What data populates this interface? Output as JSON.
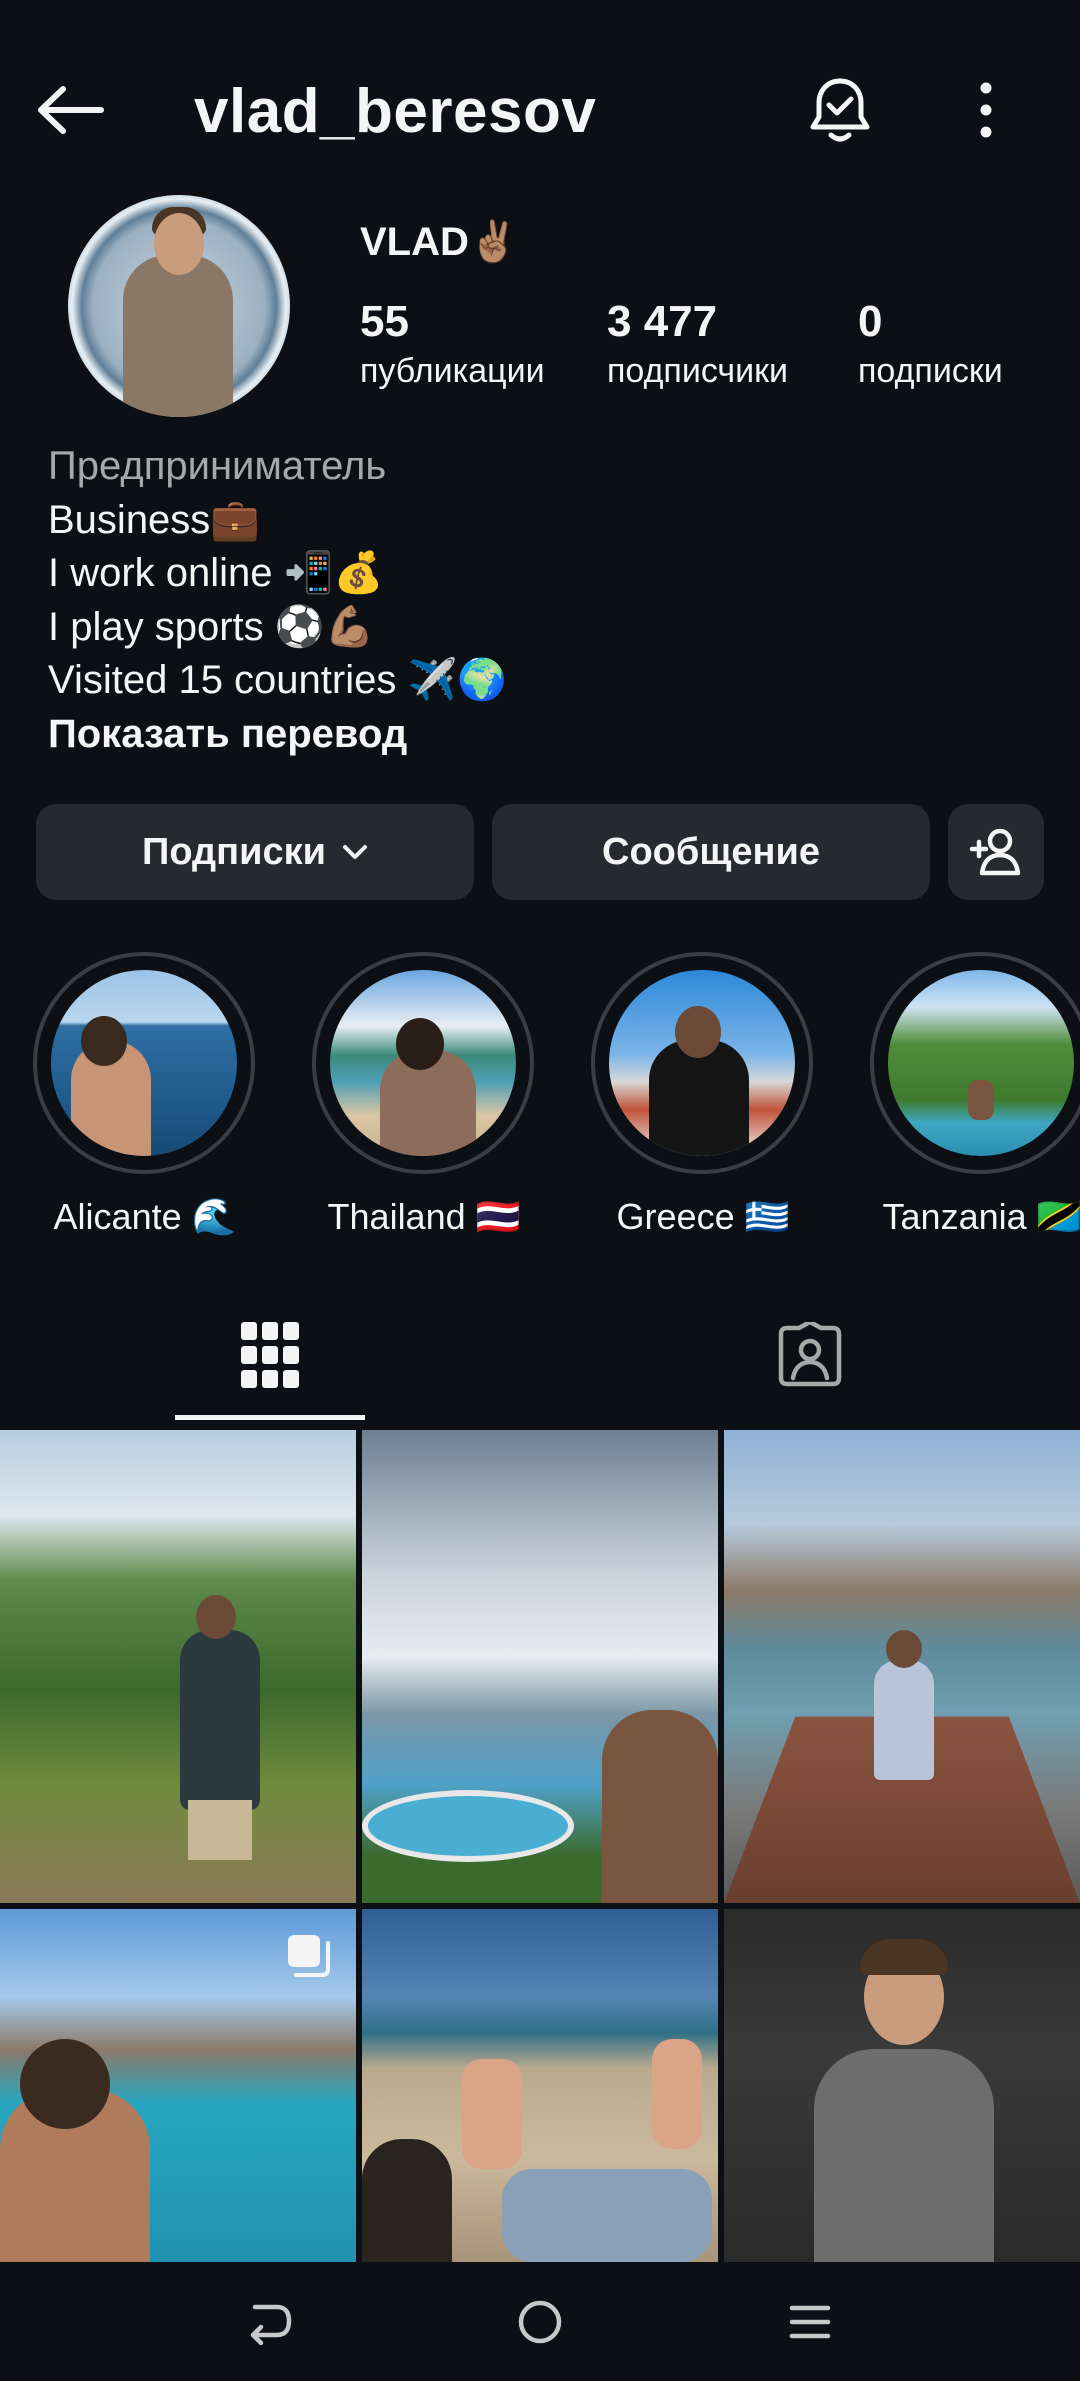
{
  "header": {
    "username": "vlad_beresov"
  },
  "profile": {
    "display_name": "VLAD✌🏽",
    "stats": [
      {
        "value": "55",
        "label": "публикации"
      },
      {
        "value": "3 477",
        "label": "подписчики"
      },
      {
        "value": "0",
        "label": "подписки"
      }
    ]
  },
  "bio": {
    "category": "Предприниматель",
    "lines": [
      "Business💼",
      "I work online 📲💰",
      "I play sports ⚽💪🏽",
      "Visited 15 countries ✈️🌍"
    ],
    "translate": "Показать перевод"
  },
  "actions": {
    "following_label": "Подписки",
    "message_label": "Сообщение"
  },
  "highlights": [
    {
      "label": "Alicante 🌊"
    },
    {
      "label": "Thailand 🇹🇭"
    },
    {
      "label": "Greece 🇬🇷"
    },
    {
      "label": "Tanzania 🇹🇿"
    }
  ],
  "colors": {
    "background": "#0c1014",
    "button": "#26292e",
    "secondary_text": "#a8a8a8"
  },
  "icons": [
    "back-arrow-icon",
    "bell-check-icon",
    "more-vertical-icon",
    "chevron-down-icon",
    "add-person-icon",
    "grid-icon",
    "tagged-icon",
    "carousel-icon",
    "back-icon",
    "home-icon",
    "recents-icon"
  ]
}
